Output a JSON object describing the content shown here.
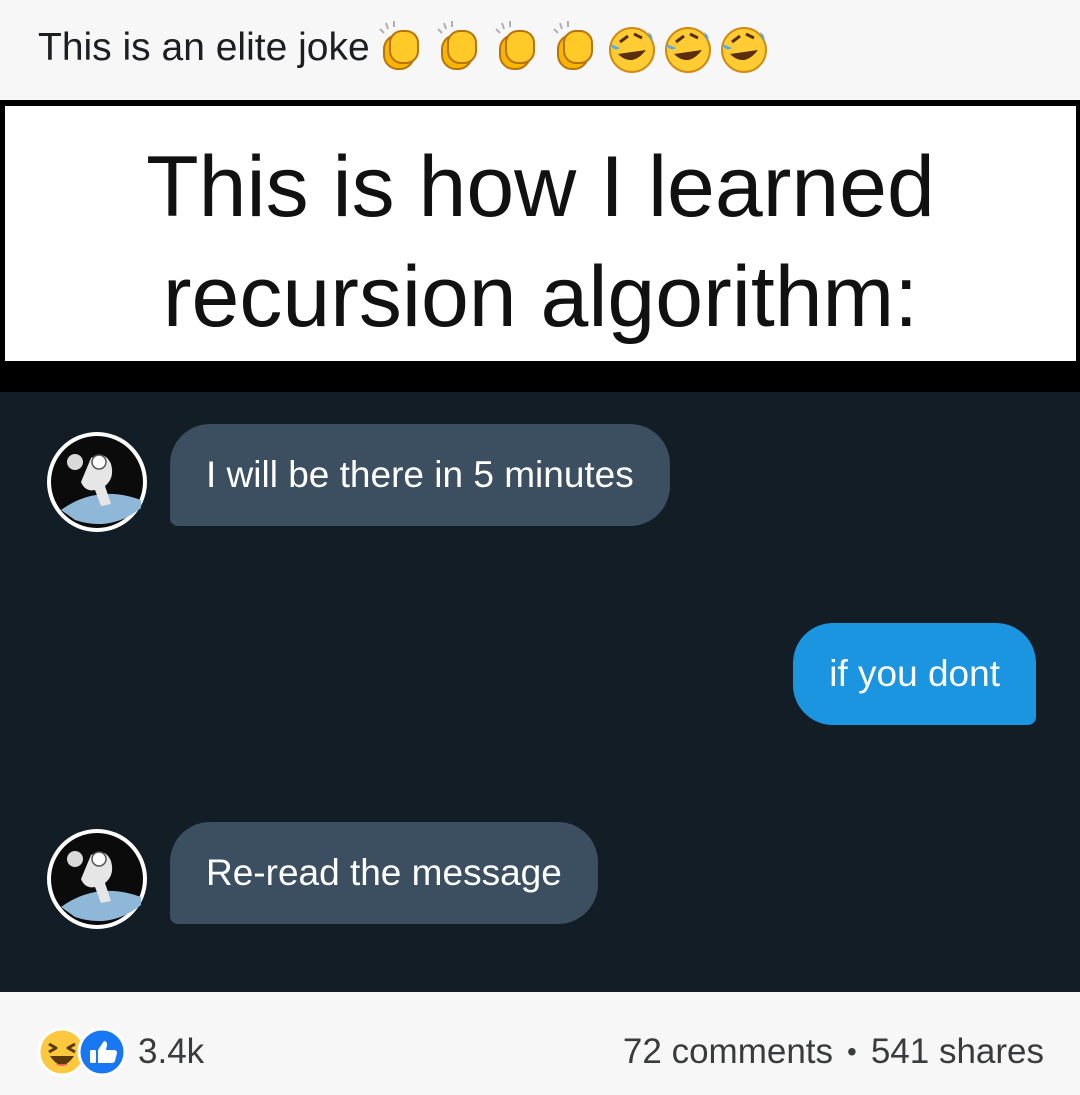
{
  "post": {
    "caption": "This is an elite joke",
    "caption_emojis": [
      "clapping-hands",
      "clapping-hands",
      "clapping-hands",
      "clapping-hands",
      "rolling-on-floor-laughing",
      "rolling-on-floor-laughing",
      "rolling-on-floor-laughing"
    ]
  },
  "meme": {
    "title_line1": "This is how I learned",
    "title_line2": "recursion algorithm:",
    "messages": [
      {
        "direction": "incoming",
        "text": "I will be there in 5 minutes",
        "avatar": "astronaut-avatar"
      },
      {
        "direction": "outgoing",
        "text": "if you dont"
      },
      {
        "direction": "incoming",
        "text": "Re-read the message",
        "avatar": "astronaut-avatar"
      }
    ]
  },
  "footer": {
    "reaction_icons": [
      "haha-reaction",
      "like-reaction"
    ],
    "reaction_count": "3.4k",
    "comments": "72 comments",
    "separator": "•",
    "shares": "541 shares"
  },
  "colors": {
    "chat_background": "#131d26",
    "incoming_bubble": "#3c4f61",
    "outgoing_bubble": "#1b95e0",
    "like_blue": "#1877f2"
  }
}
